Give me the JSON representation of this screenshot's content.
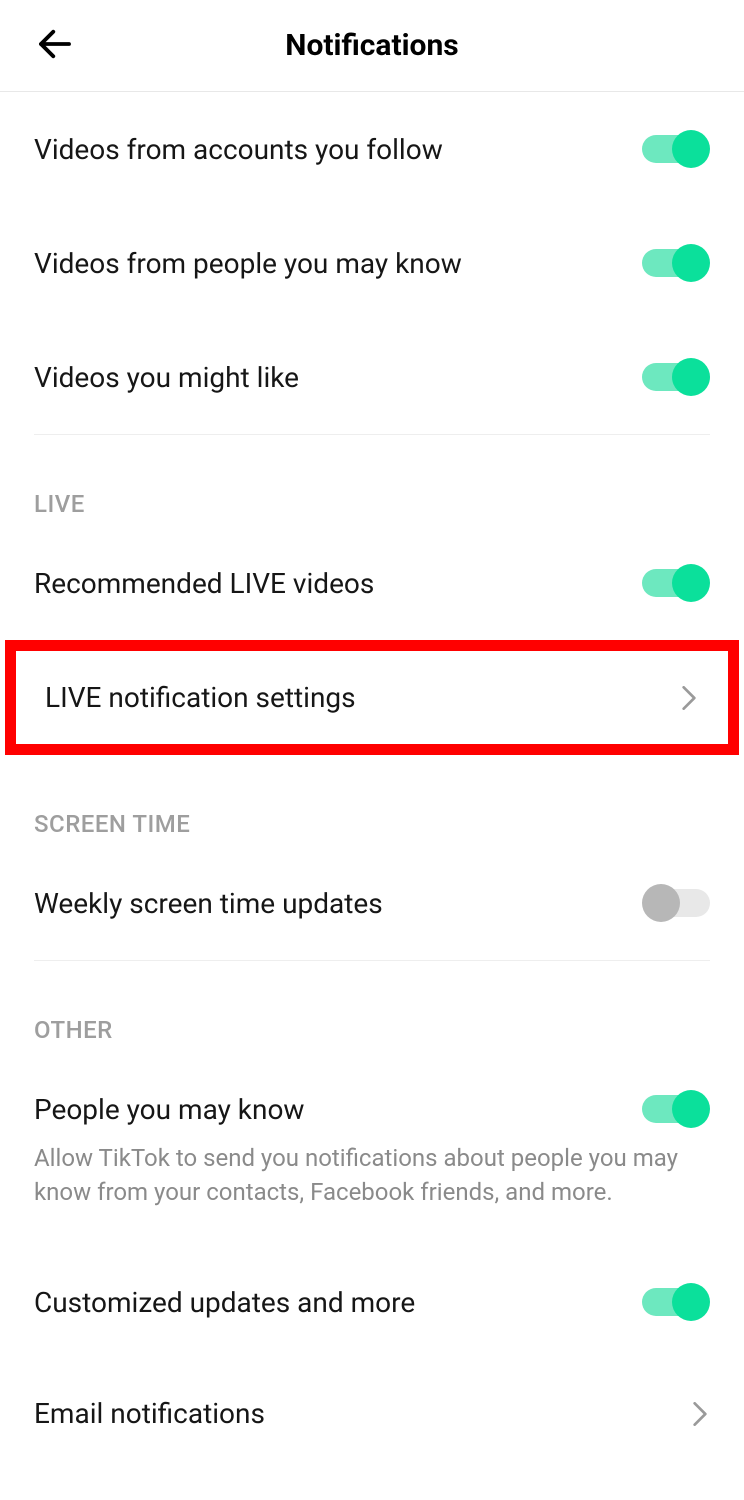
{
  "header": {
    "title": "Notifications"
  },
  "sections": {
    "top": {
      "videos_follow": "Videos from accounts you follow",
      "videos_may_know": "Videos from people you may know",
      "videos_might_like": "Videos you might like"
    },
    "live": {
      "header": "LIVE",
      "recommended": "Recommended LIVE videos",
      "settings": "LIVE notification settings"
    },
    "screen_time": {
      "header": "SCREEN TIME",
      "weekly": "Weekly screen time updates"
    },
    "other": {
      "header": "OTHER",
      "people": "People you may know",
      "people_desc": "Allow TikTok to send you notifications about people you may know from your contacts, Facebook friends, and more.",
      "customized": "Customized updates and more",
      "email": "Email notifications"
    }
  },
  "toggles": {
    "videos_follow": true,
    "videos_may_know": true,
    "videos_might_like": true,
    "recommended_live": true,
    "weekly_screen": false,
    "people_may_know": true,
    "customized": true
  }
}
